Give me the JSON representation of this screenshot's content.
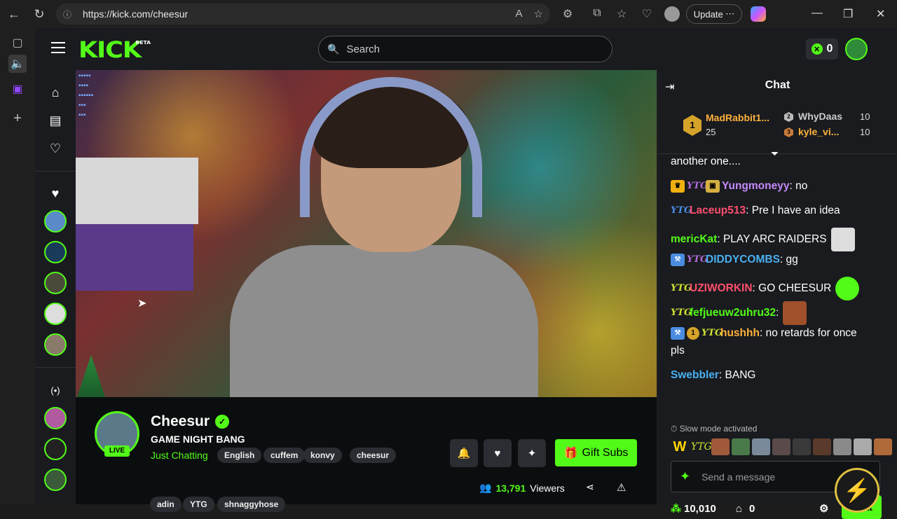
{
  "browser": {
    "url": "https://kick.com/cheesur",
    "update_label": "Update"
  },
  "header": {
    "logo": "KICK",
    "logo_sup": "BETA",
    "search_placeholder": "Search",
    "points": "0"
  },
  "channel": {
    "name": "Cheesur",
    "live_label": "LIVE",
    "title": "GAME NIGHT BANG",
    "category": "Just Chatting",
    "tags_row1": [
      "English",
      "cuffem",
      "konvy",
      "cheesur"
    ],
    "tags_row2": [
      "adin",
      "YTG",
      "shnaggyhose"
    ],
    "gift_label": "Gift Subs",
    "viewers_count": "13,791",
    "viewers_label": "Viewers"
  },
  "chat": {
    "title": "Chat",
    "leaderboard": {
      "first": {
        "rank": "1",
        "name": "MadRabbit1...",
        "amount": "25"
      },
      "second": {
        "rank": "2",
        "name": "WhyDaas",
        "amount": "10"
      },
      "third": {
        "rank": "3",
        "name": "kyle_vi...",
        "amount": "10"
      }
    },
    "messages": [
      {
        "user": "",
        "text": "another one...."
      },
      {
        "user": "Yungmoneyy",
        "text": ": no",
        "color": "#c58af9"
      },
      {
        "user": "Laceup513",
        "text": ": Pre I have an idea",
        "color": "#ff4f6d"
      },
      {
        "user": "mericKat",
        "text": ": PLAY ARC RAIDERS",
        "color": "#53fc18"
      },
      {
        "user": "DIDDYCOMBS",
        "text": ": gg",
        "color": "#4ab0f0"
      },
      {
        "user": "UZIWORKIN",
        "text": ": GO CHEESUR",
        "color": "#ff4f6d"
      },
      {
        "user": "fefjueuw2uhru32",
        "text": ":",
        "color": "#53fc18"
      },
      {
        "user": "hushhh",
        "text": ": no retards for once",
        "color": "#ffb13b"
      },
      {
        "user": "",
        "text": "pls"
      },
      {
        "user": "Swebbler",
        "text": ": BANG",
        "color": "#4ab0f0"
      }
    ],
    "badges": {
      "ytg": "YTG",
      "one": "1"
    },
    "slow_mode": "Slow mode activated",
    "emote_row_w": "W",
    "send_placeholder": "Send a message",
    "kick_points": "10,010",
    "store_count": "0",
    "chat_btn": "Chat"
  }
}
